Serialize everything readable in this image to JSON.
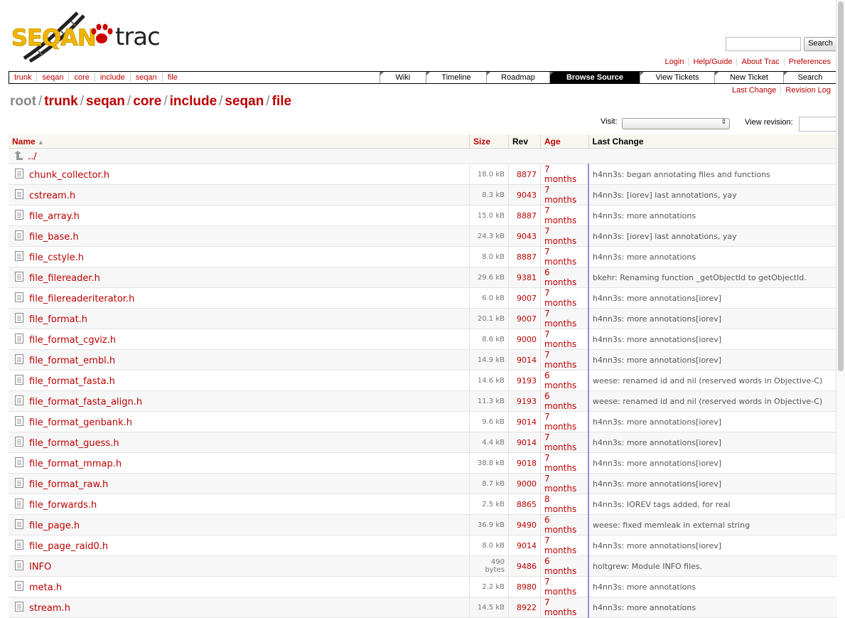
{
  "logo": {
    "brand": "SEQAN",
    "app": "trac"
  },
  "search": {
    "button_label": "Search",
    "value": ""
  },
  "metanav": [
    "Login",
    "Help/Guide",
    "About Trac",
    "Preferences"
  ],
  "crumbnav": [
    "trunk",
    "seqan",
    "core",
    "include",
    "seqan",
    "file"
  ],
  "mainnav": [
    {
      "label": "Wiki",
      "active": false
    },
    {
      "label": "Timeline",
      "active": false
    },
    {
      "label": "Roadmap",
      "active": false
    },
    {
      "label": "Browse Source",
      "active": true
    },
    {
      "label": "View Tickets",
      "active": false
    },
    {
      "label": "New Ticket",
      "active": false
    },
    {
      "label": "Search",
      "active": false
    }
  ],
  "ctxnav": [
    "Last Change",
    "Revision Log"
  ],
  "path": {
    "root": "root",
    "segments": [
      "trunk",
      "seqan",
      "core",
      "include",
      "seqan",
      "file"
    ]
  },
  "visit": {
    "label": "Visit:",
    "value": ""
  },
  "view_revision": {
    "label": "View revision:",
    "value": ""
  },
  "table": {
    "headers": {
      "name": "Name",
      "size": "Size",
      "rev": "Rev",
      "age": "Age",
      "change": "Last Change"
    },
    "parent": "../",
    "rows": [
      {
        "name": "chunk_collector.h",
        "size": "18.0 kB",
        "rev": "8877",
        "age": "7 months",
        "change": "h4nn3s: began annotating files and functions"
      },
      {
        "name": "cstream.h",
        "size": "8.3 kB",
        "rev": "9043",
        "age": "7 months",
        "change": "h4nn3s: [iorev] last annotations, yay"
      },
      {
        "name": "file_array.h",
        "size": "15.0 kB",
        "rev": "8887",
        "age": "7 months",
        "change": "h4nn3s: more annotations"
      },
      {
        "name": "file_base.h",
        "size": "24.3 kB",
        "rev": "9043",
        "age": "7 months",
        "change": "h4nn3s: [iorev] last annotations, yay"
      },
      {
        "name": "file_cstyle.h",
        "size": "8.0 kB",
        "rev": "8887",
        "age": "7 months",
        "change": "h4nn3s: more annotations"
      },
      {
        "name": "file_filereader.h",
        "size": "29.6 kB",
        "rev": "9381",
        "age": "6 months",
        "change": "bkehr: Renaming function _getObjectId to getObjectId."
      },
      {
        "name": "file_filereaderiterator.h",
        "size": "6.0 kB",
        "rev": "9007",
        "age": "7 months",
        "change": "h4nn3s: more annotations[iorev]"
      },
      {
        "name": "file_format.h",
        "size": "20.1 kB",
        "rev": "9007",
        "age": "7 months",
        "change": "h4nn3s: more annotations[iorev]"
      },
      {
        "name": "file_format_cgviz.h",
        "size": "8.6 kB",
        "rev": "9000",
        "age": "7 months",
        "change": "h4nn3s: more annotations[iorev]"
      },
      {
        "name": "file_format_embl.h",
        "size": "14.9 kB",
        "rev": "9014",
        "age": "7 months",
        "change": "h4nn3s: more annotations[iorev]"
      },
      {
        "name": "file_format_fasta.h",
        "size": "14.6 kB",
        "rev": "9193",
        "age": "6 months",
        "change": "weese: renamed id and nil (reserved words in Objective-C)"
      },
      {
        "name": "file_format_fasta_align.h",
        "size": "11.3 kB",
        "rev": "9193",
        "age": "6 months",
        "change": "weese: renamed id and nil (reserved words in Objective-C)"
      },
      {
        "name": "file_format_genbank.h",
        "size": "9.6 kB",
        "rev": "9014",
        "age": "7 months",
        "change": "h4nn3s: more annotations[iorev]"
      },
      {
        "name": "file_format_guess.h",
        "size": "4.4 kB",
        "rev": "9014",
        "age": "7 months",
        "change": "h4nn3s: more annotations[iorev]"
      },
      {
        "name": "file_format_mmap.h",
        "size": "38.8 kB",
        "rev": "9018",
        "age": "7 months",
        "change": "h4nn3s: more annotations[iorev]"
      },
      {
        "name": "file_format_raw.h",
        "size": "8.7 kB",
        "rev": "9000",
        "age": "7 months",
        "change": "h4nn3s: more annotations[iorev]"
      },
      {
        "name": "file_forwards.h",
        "size": "2.5 kB",
        "rev": "8865",
        "age": "8 months",
        "change": "h4nn3s: IOREV tags added, for real"
      },
      {
        "name": "file_page.h",
        "size": "36.9 kB",
        "rev": "9490",
        "age": "6 months",
        "change": "weese: fixed memleak in external string"
      },
      {
        "name": "file_page_raid0.h",
        "size": "8.0 kB",
        "rev": "9014",
        "age": "7 months",
        "change": "h4nn3s: more annotations[iorev]"
      },
      {
        "name": "INFO",
        "size": "490 bytes",
        "rev": "9486",
        "age": "6 months",
        "change": "holtgrew: Module INFO files."
      },
      {
        "name": "meta.h",
        "size": "2.2 kB",
        "rev": "8980",
        "age": "7 months",
        "change": "h4nn3s: more annotations"
      },
      {
        "name": "stream.h",
        "size": "14.5 kB",
        "rev": "8922",
        "age": "7 months",
        "change": "h4nn3s: more annotations"
      }
    ]
  }
}
